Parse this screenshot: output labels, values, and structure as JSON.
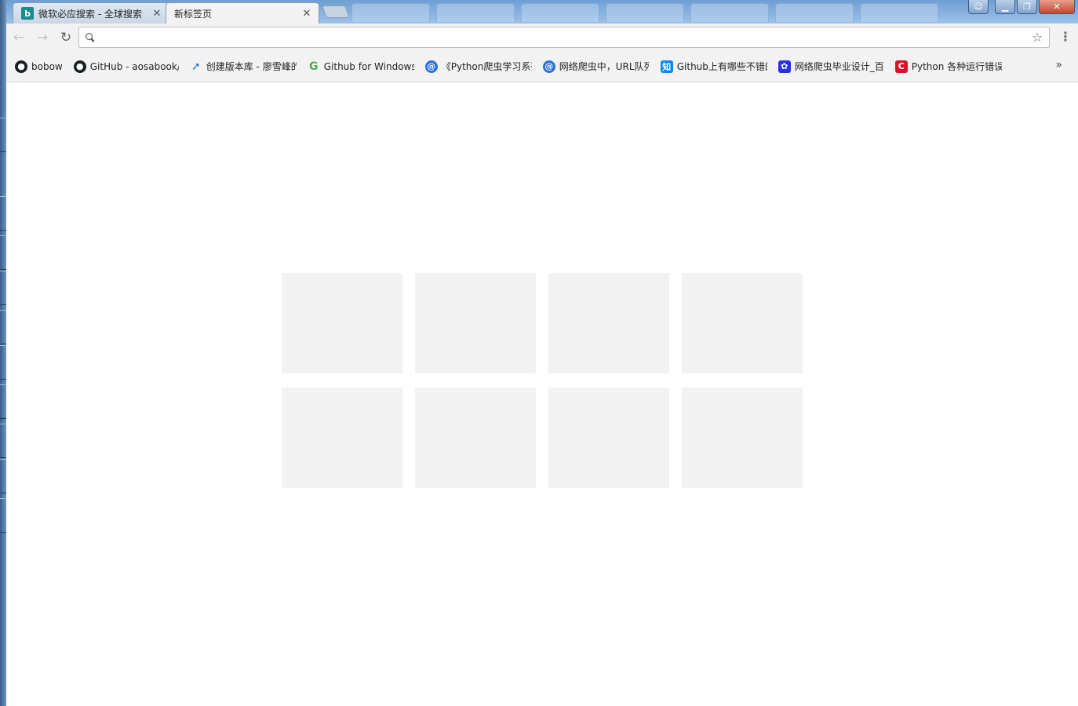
{
  "tabs": [
    {
      "title": "微软必应搜索 - 全球搜索",
      "favicon": "bing-icon",
      "state": "inactive"
    },
    {
      "title": "新标签页",
      "favicon": "",
      "state": "active"
    }
  ],
  "window_controls": {
    "profile": "profile-icon",
    "minimize": "minimize-icon",
    "maximize": "maximize-icon",
    "close": "close-icon"
  },
  "toolbar": {
    "back": "←",
    "forward": "→",
    "reload": "↻",
    "star": "☆",
    "menu": "⋮"
  },
  "omnibox": {
    "value": "",
    "placeholder": ""
  },
  "bookmarks": [
    {
      "label": "bobow",
      "icon": "github-icon"
    },
    {
      "label": "GitHub - aosabook/",
      "icon": "github-icon"
    },
    {
      "label": "创建版本库 - 廖雪峰的",
      "icon": "rocket-icon"
    },
    {
      "label": "Github for Windows",
      "icon": "github-windows-icon"
    },
    {
      "label": "《Python爬虫学习系列",
      "icon": "cnblogs-icon"
    },
    {
      "label": "网络爬虫中，URL队列",
      "icon": "cnblogs-icon"
    },
    {
      "label": "Github上有哪些不错的",
      "icon": "zhihu-icon"
    },
    {
      "label": "网络爬虫毕业设计_百",
      "icon": "baidu-icon"
    },
    {
      "label": "Python 各种运行错误",
      "icon": "csdn-icon"
    }
  ],
  "bookmarks_more": "»",
  "colors": {
    "tile": "#f2f2f2",
    "toolbar": "#f2f2f2",
    "titlebar": "#6e9ed3"
  },
  "most_visited_tiles": 8
}
